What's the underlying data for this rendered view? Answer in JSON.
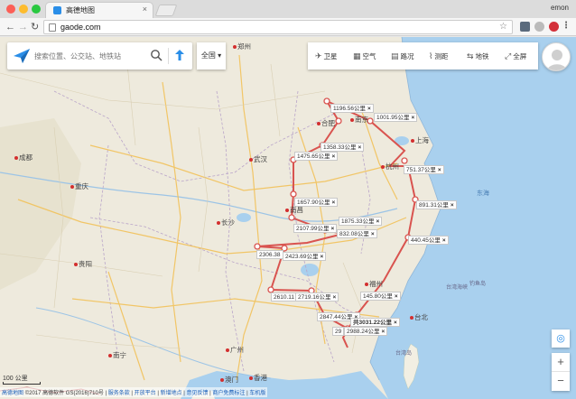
{
  "browser": {
    "tab_title": "高德地图",
    "user_name": "emon",
    "url": "gaode.com"
  },
  "search": {
    "placeholder": "搜索位置、公交站、地铁站",
    "city_select": "全国 ▾"
  },
  "tools": [
    {
      "label": "卫星",
      "icon": "satellite-icon"
    },
    {
      "label": "空气",
      "icon": "air-icon"
    },
    {
      "label": "路况",
      "icon": "traffic-icon"
    },
    {
      "label": "测距",
      "icon": "ruler-icon"
    },
    {
      "label": "地铁",
      "icon": "subway-icon"
    },
    {
      "label": "全屏",
      "icon": "fullscreen-icon"
    }
  ],
  "cities": [
    {
      "name": "郑州"
    },
    {
      "name": "合肥"
    },
    {
      "name": "南京"
    },
    {
      "name": "上海"
    },
    {
      "name": "杭州"
    },
    {
      "name": "武汉"
    },
    {
      "name": "成都"
    },
    {
      "name": "重庆"
    },
    {
      "name": "长沙"
    },
    {
      "name": "南昌"
    },
    {
      "name": "贵阳"
    },
    {
      "name": "福州"
    },
    {
      "name": "台北"
    },
    {
      "name": "南宁"
    },
    {
      "name": "广州"
    },
    {
      "name": "澳门"
    },
    {
      "name": "香港"
    }
  ],
  "seas": [
    "东海",
    "台湾海峡",
    "钓鱼岛",
    "台湾岛"
  ],
  "distances": [
    {
      "label": "1196.56公里"
    },
    {
      "label": "1001.95公里"
    },
    {
      "label": "1358.33公里"
    },
    {
      "label": "1475.65公里"
    },
    {
      "label": "751.37公里"
    },
    {
      "label": "1657.90公里"
    },
    {
      "label": "891.31公里"
    },
    {
      "label": "1875.33公里"
    },
    {
      "label": "2107.99公里"
    },
    {
      "label": "832.08公里"
    },
    {
      "label": "440.45公里"
    },
    {
      "label": "2306.38"
    },
    {
      "label": "2423.69公里"
    },
    {
      "label": "145.80公里"
    },
    {
      "label": "2610.11"
    },
    {
      "label": "2719.16公里"
    },
    {
      "label": "2847.44公里"
    },
    {
      "label": "共3031.22公里"
    },
    {
      "label": "29"
    },
    {
      "label": "2988.24公里"
    }
  ],
  "map_controls": {
    "zoom_in": "+",
    "zoom_out": "−",
    "scale": "100 公里"
  },
  "footer": {
    "left": "GS(2016)710号",
    "copyright": "©2017 高德软件",
    "links": [
      "服务条款",
      "开放平台",
      "新增地点",
      "意见反馈",
      "商户免费标注",
      "车机版"
    ],
    "prefix": "高德地图"
  }
}
